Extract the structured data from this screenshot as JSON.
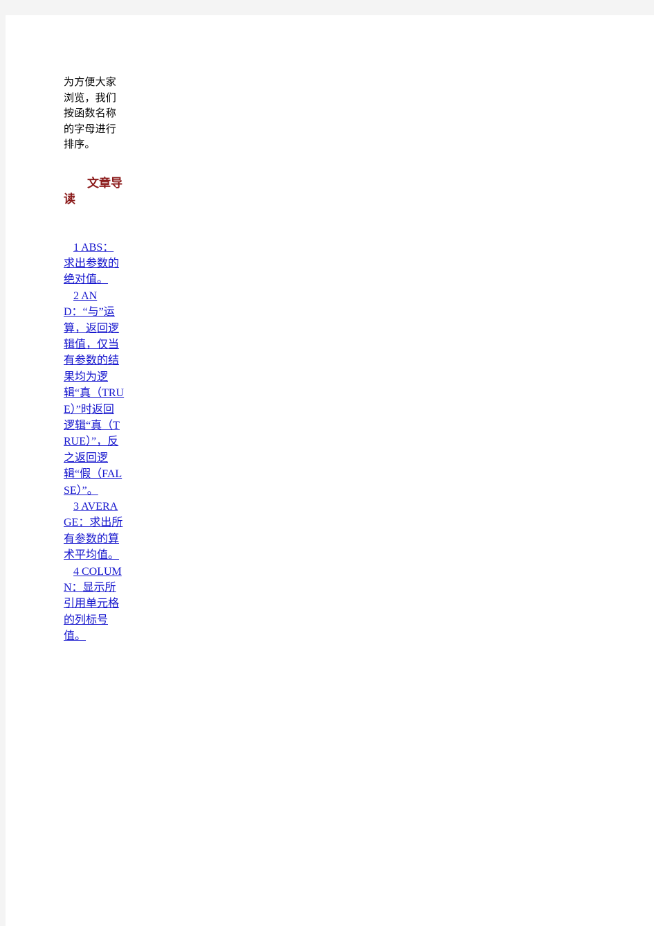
{
  "page": {
    "background_color": "#f4f4f4",
    "sheet_color": "#ffffff"
  },
  "article": {
    "intro_paragraph": "为方便大家浏览，我们按函数名称的字母进行排序。",
    "heading": "文章导读",
    "heading_color": "#8b1a1a",
    "link_color": "#1414cd"
  },
  "toc": {
    "items": [
      {
        "index": "1",
        "text": "ABS：求出参数的绝对值。",
        "full": " 1 ABS：求出参数的绝对值。 "
      },
      {
        "index": "2",
        "text": "AND：“与”运算，返回逻辑值，仅当有参数的结果均为逻辑“真（TRUE）”时返回逻辑“真（TRUE）”，反之返回逻辑“假（FALSE）”。",
        "full": " 2 AND：“与”运算，返回逻辑值，仅当有参数的结果均为逻辑“真（TRUE）”时返回逻辑“真（TRUE）”，反之返回逻辑“假（FALSE）”。 "
      },
      {
        "index": "3",
        "text": "AVERAGE：求出所有参数的算术平均值。",
        "full": " 3 AVERAGE：求出所有参数的算术平均值。 "
      },
      {
        "index": "4",
        "text": "COLUMN：显示所引用单元格的列标号值。",
        "full": " 4 COLUMN：显示所引用单元格的列标号值。 "
      }
    ]
  }
}
